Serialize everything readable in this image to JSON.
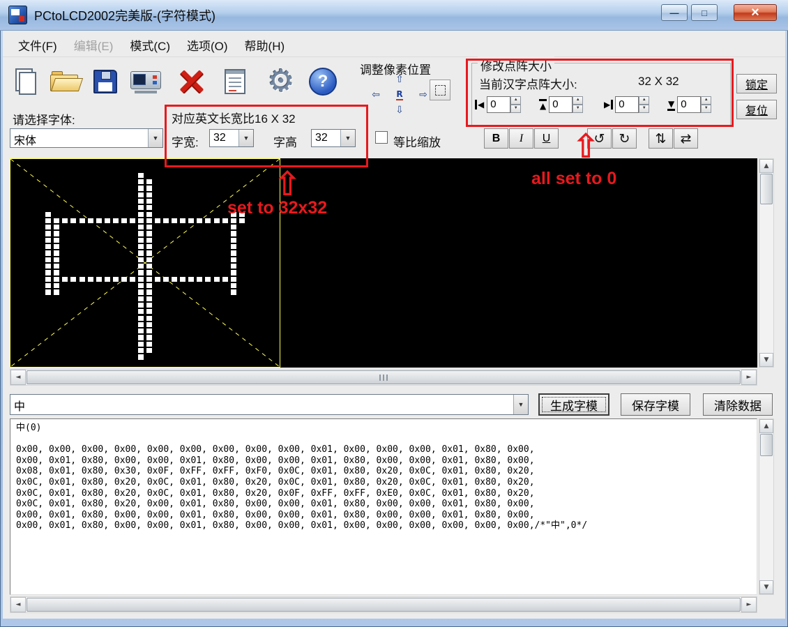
{
  "window": {
    "title": "PCtoLCD2002完美版-(字符模式)",
    "controls": {
      "minimize": "—",
      "maximize": "□",
      "close": "×"
    }
  },
  "menu": {
    "items": [
      {
        "label": "文件(F)",
        "enabled": true
      },
      {
        "label": "编辑(E)",
        "enabled": false
      },
      {
        "label": "模式(C)",
        "enabled": true
      },
      {
        "label": "选项(O)",
        "enabled": true
      },
      {
        "label": "帮助(H)",
        "enabled": true
      }
    ]
  },
  "toolbar": {
    "icons": [
      "new-file-icon",
      "open-file-icon",
      "save-icon",
      "export-lcd-icon",
      "delete-icon",
      "view-data-icon",
      "settings-gear-icon",
      "help-icon"
    ],
    "help_glyph": "?",
    "gear_glyph": "⚙"
  },
  "pixel_position": {
    "label": "调整像素位置",
    "up": "⇧",
    "left": "⇦",
    "right": "⇨",
    "down": "⇩",
    "center": "R"
  },
  "matrix_size": {
    "group_label": "修改点阵大小",
    "current_size_label": "当前汉字点阵大小:",
    "current_size_value": "32 X 32",
    "spinners": [
      {
        "icon": "pad-left-icon",
        "glyph": "◀",
        "value": "0"
      },
      {
        "icon": "pad-top-icon",
        "glyph": "▲",
        "value": "0"
      },
      {
        "icon": "pad-right-icon",
        "glyph": "▶",
        "value": "0"
      },
      {
        "icon": "pad-bottom-icon",
        "glyph": "▼",
        "value": "0"
      }
    ]
  },
  "side_buttons": {
    "lock": "锁定",
    "reset": "复位"
  },
  "font_section": {
    "label": "请选择字体:",
    "font_value": "宋体",
    "ratio_label": "对应英文长宽比16 X 32",
    "char_width_label": "字宽:",
    "char_width_value": "32",
    "char_height_label": "字高",
    "char_height_value": "32",
    "scale_checkbox_label": "等比缩放",
    "scale_checkbox_checked": false,
    "bold_label": "B",
    "italic_label": "I",
    "underline_label": "U"
  },
  "transform_buttons": [
    {
      "name": "rotate-left",
      "glyph": "↺"
    },
    {
      "name": "rotate-right",
      "glyph": "↻"
    },
    {
      "name": "flip-vertical",
      "glyph": "⇅"
    },
    {
      "name": "flip-horizontal",
      "glyph": "⇄"
    }
  ],
  "icons": {
    "spin_up": "▲",
    "spin_down": "▼",
    "scroll_up": "▲",
    "scroll_down": "▼",
    "scroll_left": "◄",
    "scroll_right": "►",
    "dropdown": "▼"
  },
  "canvas": {
    "grid_size": 32,
    "background": "#000000",
    "pixel_color": "#ffffff",
    "guide_color": "#ffff55"
  },
  "annotations": {
    "color": "#e8191d",
    "arrow_glyph": "⇧",
    "size_note": "set to 32x32",
    "zero_note": "all set to 0"
  },
  "charmap": {
    "input_value": "中",
    "generate_label": "生成字模",
    "save_label": "保存字模",
    "clear_label": "清除数据"
  },
  "output": {
    "header": "中(0)",
    "lines": [
      "0x00, 0x00, 0x00, 0x00, 0x00, 0x00, 0x00, 0x00, 0x00, 0x01, 0x00, 0x00, 0x00, 0x01, 0x80, 0x00,",
      "0x00, 0x01, 0x80, 0x00, 0x00, 0x01, 0x80, 0x00, 0x00, 0x01, 0x80, 0x00, 0x00, 0x01, 0x80, 0x00,",
      "0x08, 0x01, 0x80, 0x30, 0x0F, 0xFF, 0xFF, 0xF0, 0x0C, 0x01, 0x80, 0x20, 0x0C, 0x01, 0x80, 0x20,",
      "0x0C, 0x01, 0x80, 0x20, 0x0C, 0x01, 0x80, 0x20, 0x0C, 0x01, 0x80, 0x20, 0x0C, 0x01, 0x80, 0x20,",
      "0x0C, 0x01, 0x80, 0x20, 0x0C, 0x01, 0x80, 0x20, 0x0F, 0xFF, 0xFF, 0xE0, 0x0C, 0x01, 0x80, 0x20,",
      "0x0C, 0x01, 0x80, 0x20, 0x00, 0x01, 0x80, 0x00, 0x00, 0x01, 0x80, 0x00, 0x00, 0x01, 0x80, 0x00,",
      "0x00, 0x01, 0x80, 0x00, 0x00, 0x01, 0x80, 0x00, 0x00, 0x01, 0x80, 0x00, 0x00, 0x01, 0x80, 0x00,",
      "0x00, 0x01, 0x80, 0x00, 0x00, 0x01, 0x80, 0x00, 0x00, 0x01, 0x00, 0x00, 0x00, 0x00, 0x00, 0x00,/*\"中\",0*/"
    ]
  }
}
